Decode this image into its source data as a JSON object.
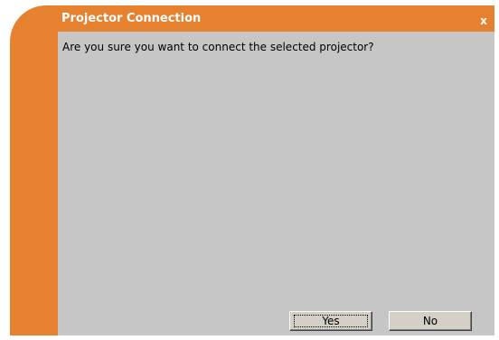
{
  "dialog": {
    "title": "Projector Connection",
    "close_label": "x",
    "message": "Are you sure you want to connect the selected projector?",
    "buttons": {
      "yes_label": "Yes",
      "no_label": "No"
    }
  },
  "colors": {
    "accent": "#e5812f",
    "body_background": "#c6c6c6",
    "button_face": "#d4d0c8"
  }
}
